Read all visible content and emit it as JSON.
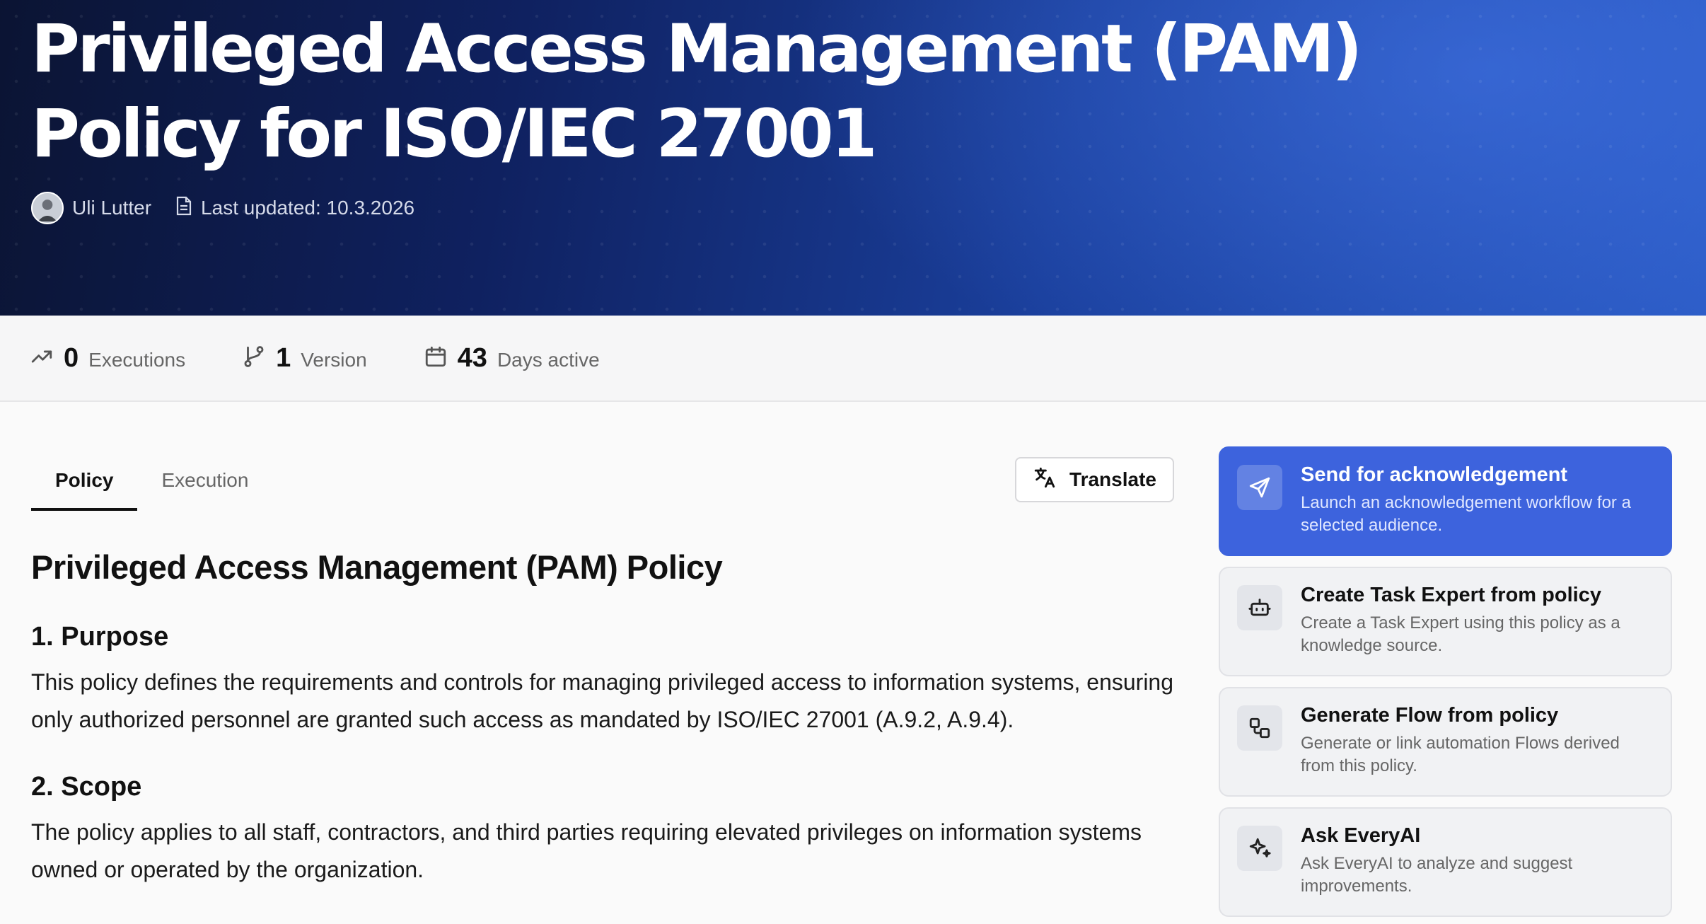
{
  "hero": {
    "title": "Privileged Access Management (PAM) Policy for ISO/IEC 27001",
    "author": "Uli Lutter",
    "last_updated": "Last updated: 10.3.2026"
  },
  "stats": [
    {
      "value": "0",
      "label": "Executions",
      "icon": "trending-up-icon"
    },
    {
      "value": "1",
      "label": "Version",
      "icon": "git-branch-icon"
    },
    {
      "value": "43",
      "label": "Days active",
      "icon": "calendar-icon"
    }
  ],
  "tabs": [
    {
      "label": "Policy",
      "active": true
    },
    {
      "label": "Execution",
      "active": false
    }
  ],
  "translate_label": "Translate",
  "document": {
    "heading": "Privileged Access Management (PAM) Policy",
    "sections": [
      {
        "title": "1. Purpose",
        "body": "This policy defines the requirements and controls for managing privileged access to information systems, ensuring only authorized personnel are granted such access as mandated by ISO/IEC 27001 (A.9.2, A.9.4)."
      },
      {
        "title": "2. Scope",
        "body": "The policy applies to all staff, contractors, and third parties requiring elevated privileges on information systems owned or operated by the organization."
      }
    ]
  },
  "actions": [
    {
      "title": "Send for acknowledgement",
      "desc": "Launch an acknowledgement workflow for a selected audience.",
      "icon": "send-icon",
      "primary": true
    },
    {
      "title": "Create Task Expert from policy",
      "desc": "Create a Task Expert using this policy as a knowledge source.",
      "icon": "bot-icon",
      "primary": false
    },
    {
      "title": "Generate Flow from policy",
      "desc": "Generate or link automation Flows derived from this policy.",
      "icon": "workflow-icon",
      "primary": false
    },
    {
      "title": "Ask EveryAI",
      "desc": "Ask EveryAI to analyze and suggest improvements.",
      "icon": "sparkles-icon",
      "primary": false
    }
  ],
  "colors": {
    "accent": "#3d63dd",
    "hero_dark": "#0b1433",
    "hero_light": "#2a5ac4"
  }
}
